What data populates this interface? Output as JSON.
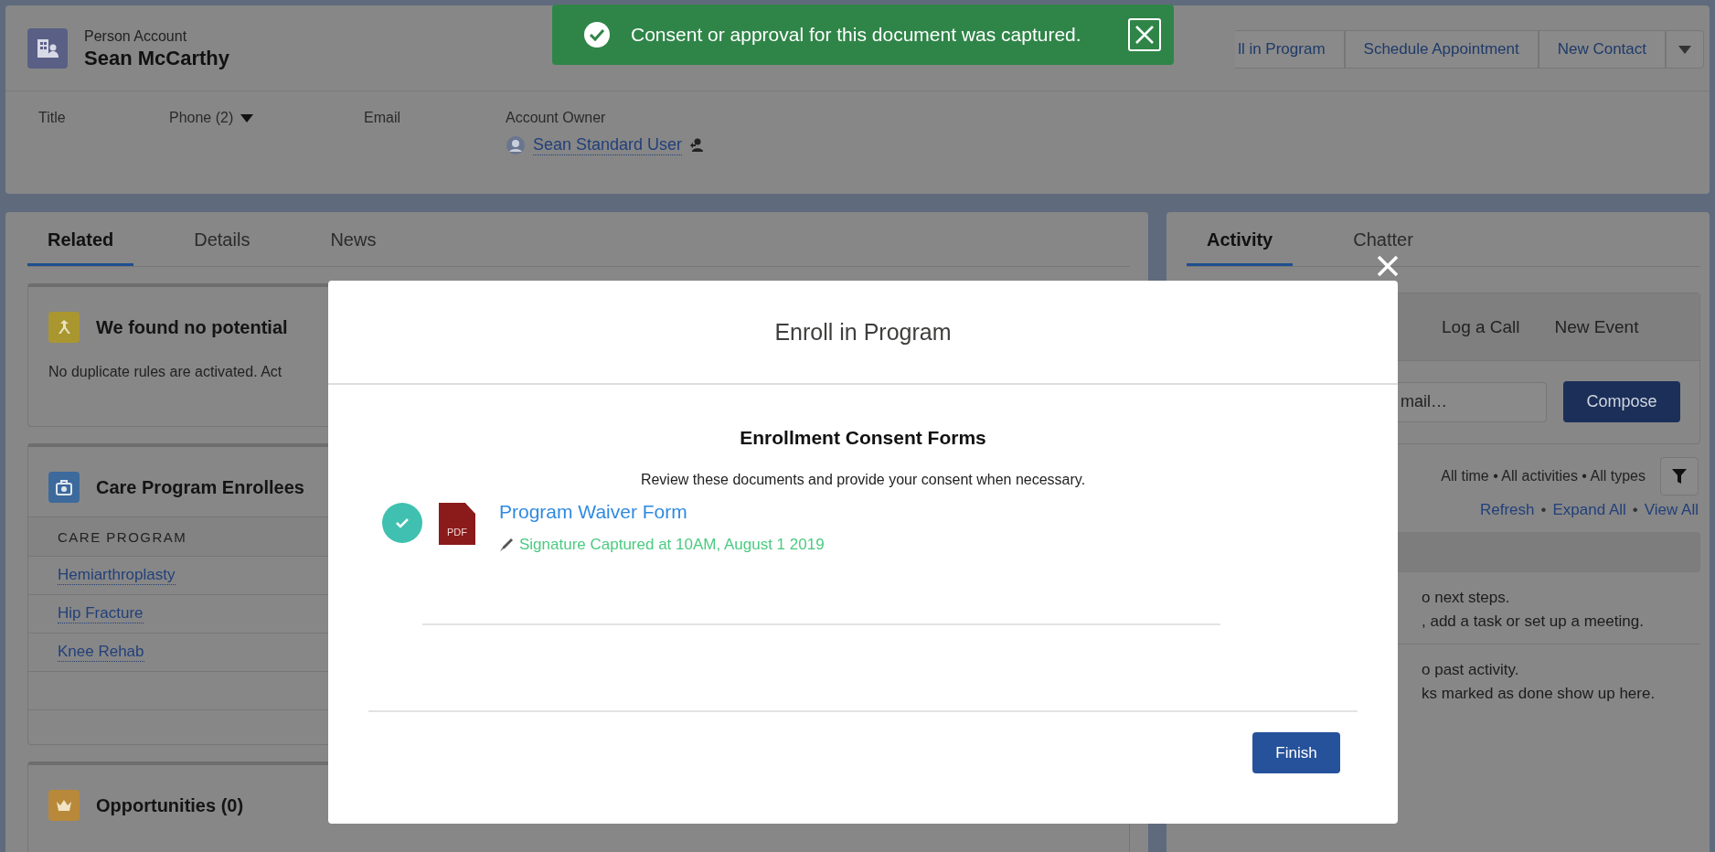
{
  "toast": {
    "message": "Consent or approval for this document was captured."
  },
  "record": {
    "type_label": "Person Account",
    "name": "Sean McCarthy"
  },
  "actions": [
    "ll in Program",
    "Schedule Appointment",
    "New Contact"
  ],
  "fields": [
    {
      "label": "Title",
      "dropdown": false
    },
    {
      "label": "Phone (2)",
      "dropdown": true
    },
    {
      "label": "Email",
      "dropdown": false
    },
    {
      "label": "Account Owner",
      "dropdown": false,
      "value": "Sean Standard User"
    }
  ],
  "main_tabs": [
    {
      "label": "Related",
      "selected": true
    },
    {
      "label": "Details",
      "selected": false
    },
    {
      "label": "News",
      "selected": false
    }
  ],
  "duplicates": {
    "title": "We found no potential",
    "text": "No duplicate rules are activated. Act"
  },
  "enrollees": {
    "title": "Care Program Enrollees",
    "column": "CARE PROGRAM",
    "rows": [
      "Hemiarthroplasty",
      "Hip Fracture",
      "Knee Rehab"
    ]
  },
  "opportunities": {
    "title": "Opportunities (0)"
  },
  "activity": {
    "tabs": [
      {
        "label": "Activity",
        "selected": true
      },
      {
        "label": "Chatter",
        "selected": false
      }
    ],
    "actions": [
      "Log a Call",
      "New Event"
    ],
    "email_placeholder": "mail…",
    "compose": "Compose",
    "filter": "All time • All activities • All types",
    "links": [
      "Refresh",
      "Expand All",
      "View All"
    ],
    "separator": "•",
    "next_steps": [
      "o next steps.",
      ", add a task or set up a meeting."
    ],
    "past": [
      "o past activity.",
      "ks marked as done show up here."
    ]
  },
  "modal": {
    "title": "Enroll in Program",
    "heading": "Enrollment Consent Forms",
    "description": "Review these documents and provide your consent when necessary.",
    "documents": [
      {
        "name": "Program Waiver Form",
        "file_type": "PDF",
        "status": "Signature Captured at 10AM, August 1 2019",
        "signed": true
      }
    ],
    "finish": "Finish"
  }
}
